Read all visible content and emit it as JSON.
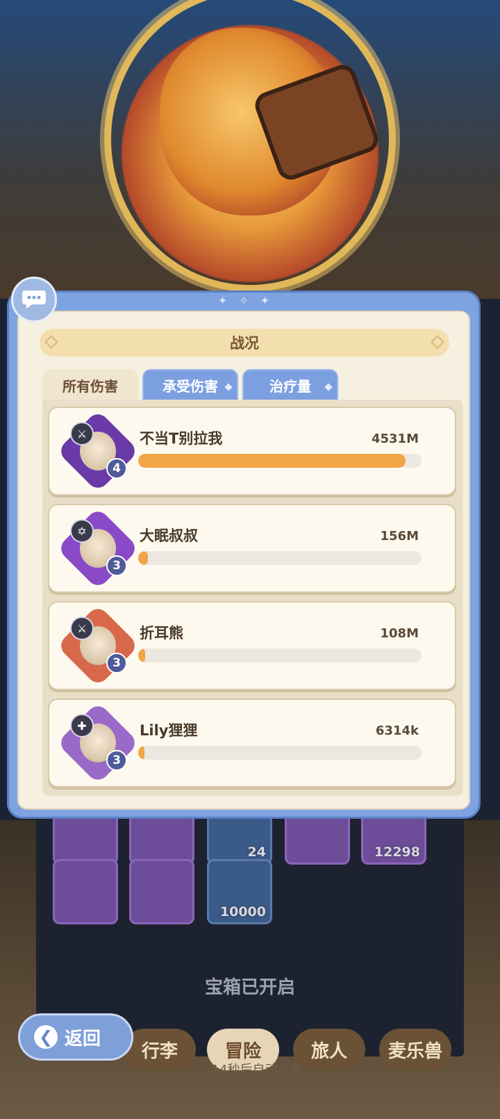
{
  "panel": {
    "title": "战况",
    "tabs": [
      {
        "label": "所有伤害",
        "active": true
      },
      {
        "label": "承受伤害",
        "active": false
      },
      {
        "label": "治疗量",
        "active": false
      }
    ],
    "rows": [
      {
        "name": "不当T别拉我",
        "value": "4531M",
        "level": "4",
        "fraction": 0.943,
        "frame_color": "#6a3aa8",
        "role_icon": "sword-icon"
      },
      {
        "name": "大眠叔叔",
        "value": "156M",
        "level": "3",
        "fraction": 0.034,
        "frame_color": "#8a4ac8",
        "role_icon": "star-shield-icon"
      },
      {
        "name": "折耳熊",
        "value": "108M",
        "level": "3",
        "fraction": 0.024,
        "frame_color": "#d8684a",
        "role_icon": "sword-icon"
      },
      {
        "name": "Lily狸狸",
        "value": "6314k",
        "level": "3",
        "fraction": 0.0014,
        "frame_color": "#9a6ac8",
        "role_icon": "cross-icon"
      }
    ]
  },
  "background": {
    "item_counts": [
      "24",
      "12298",
      "10000"
    ],
    "chest_status": "宝箱已开启"
  },
  "nav": {
    "back_label": "返回",
    "items": [
      "行李",
      "冒险",
      "旅人",
      "麦乐兽"
    ],
    "hint": "14秒后自动准备"
  },
  "colors": {
    "bar_fill": "#f0a646",
    "panel_blue": "#7fa3e0",
    "tab_inactive": "#7c9fe0"
  }
}
